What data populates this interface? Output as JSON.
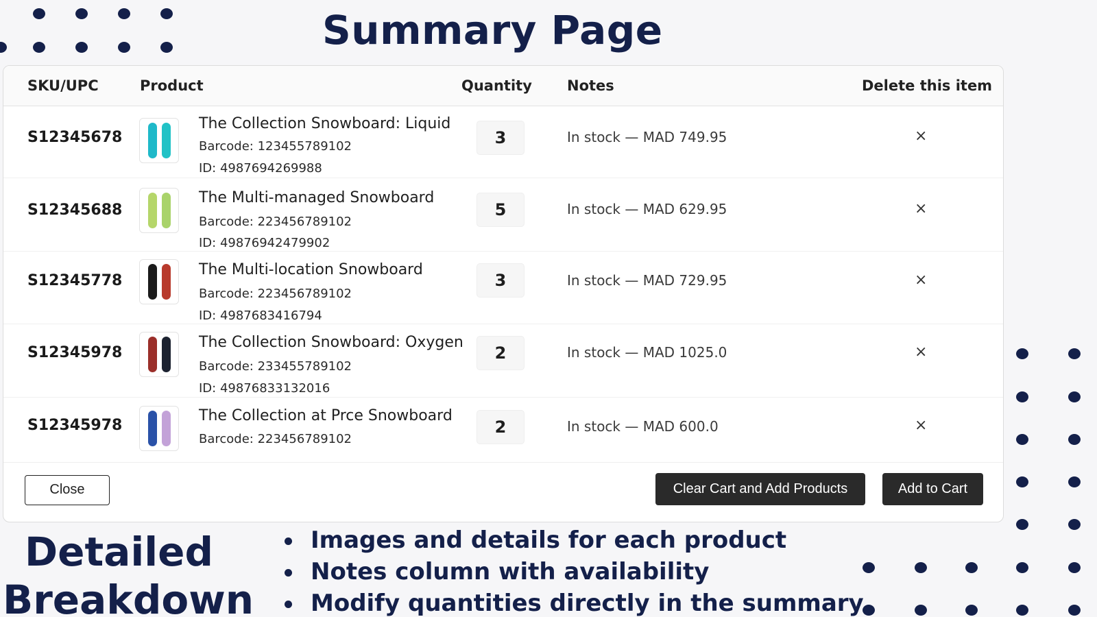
{
  "page_title": "Summary Page",
  "colors": {
    "navy": "#14204a",
    "button_dark": "#2a2a2a"
  },
  "table": {
    "columns": [
      "SKU/UPC",
      "Product",
      "Quantity",
      "Notes",
      "Delete this item"
    ],
    "rows": [
      {
        "sku": "S12345678",
        "name": "The Collection Snowboard: Liquid",
        "barcode": "Barcode: 123455789102",
        "id": "ID: 4987694269988",
        "quantity": "3",
        "note": "In stock — MAD 749.95",
        "delete": "×",
        "thumb_colors": [
          "#1fb9c9",
          "#21c2c6"
        ]
      },
      {
        "sku": "S12345688",
        "name": "The Multi-managed Snowboard",
        "barcode": "Barcode: 223456789102",
        "id": "ID: 49876942479902",
        "quantity": "5",
        "note": "In stock — MAD 629.95",
        "delete": "×",
        "thumb_colors": [
          "#b5d66a",
          "#a9d36a"
        ]
      },
      {
        "sku": "S12345778",
        "name": "The Multi-location Snowboard",
        "barcode": "Barcode: 223456789102",
        "id": "ID: 4987683416794",
        "quantity": "3",
        "note": "In stock — MAD 729.95",
        "delete": "×",
        "thumb_colors": [
          "#1b1b1b",
          "#b83a2c"
        ]
      },
      {
        "sku": "S12345978",
        "name": "The Collection Snowboard: Oxygen",
        "barcode": "Barcode: 233455789102",
        "id": "ID: 49876833132016",
        "quantity": "2",
        "note": "In stock — MAD 1025.0",
        "delete": "×",
        "thumb_colors": [
          "#9b2f2a",
          "#1c2230"
        ]
      },
      {
        "sku": "S12345978",
        "name": "The Collection at Prce Snowboard",
        "barcode": "Barcode: 223456789102",
        "id": "",
        "quantity": "2",
        "note": "In stock — MAD 600.0",
        "delete": "×",
        "thumb_colors": [
          "#2a52a8",
          "#c3a2d8"
        ]
      }
    ]
  },
  "footer": {
    "close_label": "Close",
    "clear_label": "Clear Cart and Add Products",
    "add_label": "Add to Cart"
  },
  "breakdown": {
    "heading_line1": "Detailed",
    "heading_line2": "Breakdown",
    "bullets": [
      "Images and details for each product",
      "Notes column with availability",
      "Modify quantities directly in the summary"
    ]
  }
}
